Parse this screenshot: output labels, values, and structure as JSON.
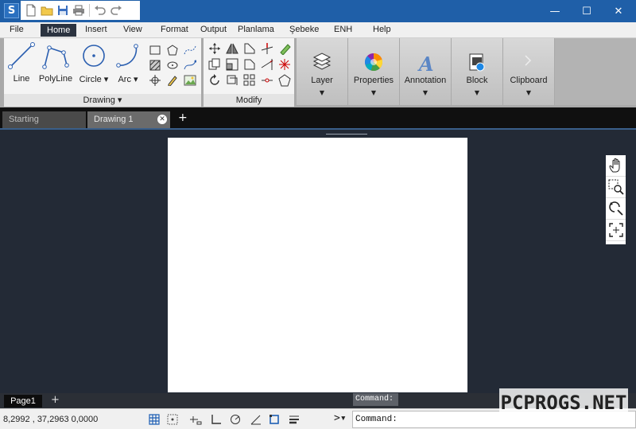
{
  "titlebar": {
    "logo_letter": "S",
    "controls": [
      "—",
      "☐",
      "✕"
    ]
  },
  "menu": {
    "items": [
      "File",
      "Home",
      "Insert",
      "View",
      "Format",
      "Output",
      "Planlama",
      "Şebeke",
      "ENH",
      "Help"
    ],
    "active": "Home"
  },
  "ribbon": {
    "drawing": {
      "title": "Drawing ▾",
      "tools": [
        "Line",
        "PolyLine",
        "Circle ▾",
        "Arc ▾"
      ]
    },
    "modify": {
      "title": "Modify"
    },
    "buttons": [
      {
        "label": "Layer",
        "arrow": "▼"
      },
      {
        "label": "Properties",
        "arrow": "▼"
      },
      {
        "label": "Annotation",
        "arrow": "▼"
      },
      {
        "label": "Block",
        "arrow": "▼"
      },
      {
        "label": "Clipboard",
        "arrow": "▼"
      }
    ]
  },
  "tabs": {
    "items": [
      "Starting",
      "Drawing 1"
    ],
    "active": "Drawing 1",
    "close": "✕",
    "add": "+"
  },
  "layout": {
    "page": "Page1",
    "add": "+",
    "command_label": "Command:"
  },
  "status": {
    "coords": "8,2992 , 37,2963  0,0000",
    "prompt": ">▾",
    "command_input": "Command:"
  },
  "watermark": "PCPROGS.NET",
  "colors": {
    "titlebar": "#1f5fa8",
    "canvas": "#232a36",
    "menu_active": "#2b3340"
  }
}
